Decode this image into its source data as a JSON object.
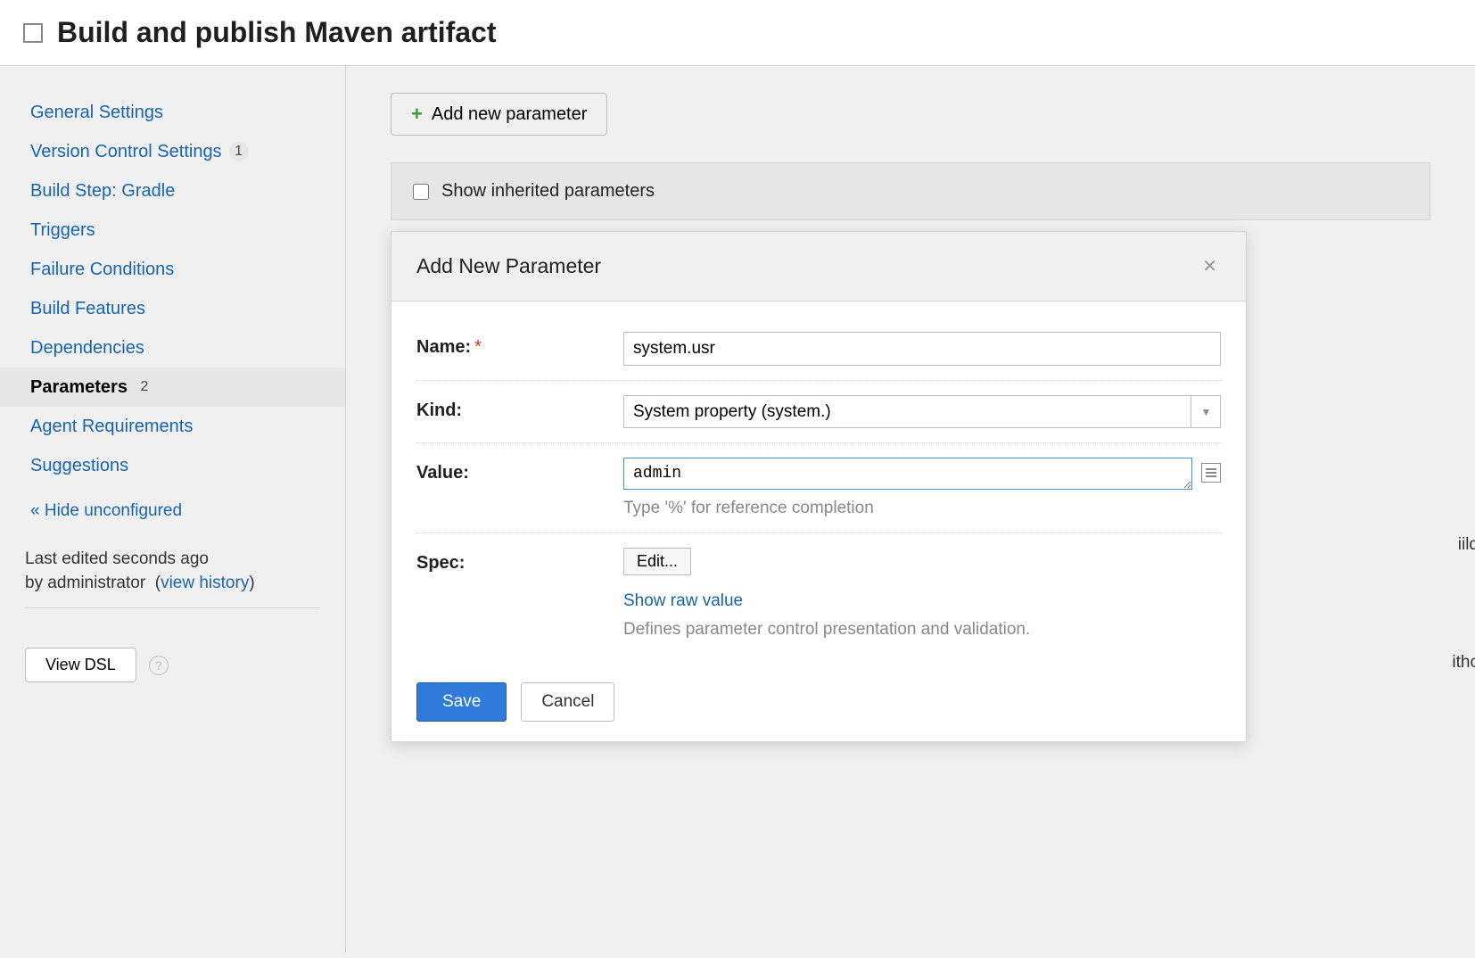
{
  "header": {
    "title": "Build and publish Maven artifact"
  },
  "sidebar": {
    "items": [
      {
        "label": "General Settings",
        "badge": null
      },
      {
        "label": "Version Control Settings",
        "badge": "1"
      },
      {
        "label": "Build Step: Gradle",
        "badge": null
      },
      {
        "label": "Triggers",
        "badge": null
      },
      {
        "label": "Failure Conditions",
        "badge": null
      },
      {
        "label": "Build Features",
        "badge": null
      },
      {
        "label": "Dependencies",
        "badge": null
      },
      {
        "label": "Parameters",
        "badge": "2",
        "active": true
      },
      {
        "label": "Agent Requirements",
        "badge": null
      },
      {
        "label": "Suggestions",
        "badge": null
      }
    ],
    "hide_unconfigured": "« Hide unconfigured",
    "meta": {
      "last_edited_label": "Last edited",
      "last_edited_value": "seconds ago",
      "by_label": "by",
      "by_value": "administrator",
      "view_history": "view history"
    },
    "view_dsl": "View DSL"
  },
  "main": {
    "add_param_btn": "Add new parameter",
    "show_inherited": "Show inherited parameters",
    "bg_fragments": {
      "a": "iild",
      "b": "ithc"
    }
  },
  "dialog": {
    "title": "Add New Parameter",
    "name_label": "Name:",
    "name_value": "system.usr",
    "kind_label": "Kind:",
    "kind_value": "System property (system.)",
    "value_label": "Value:",
    "value_value": "admin",
    "value_hint": "Type '%' for reference completion",
    "spec_label": "Spec:",
    "edit_btn": "Edit...",
    "show_raw": "Show raw value",
    "spec_hint": "Defines parameter control presentation and validation.",
    "save": "Save",
    "cancel": "Cancel"
  }
}
